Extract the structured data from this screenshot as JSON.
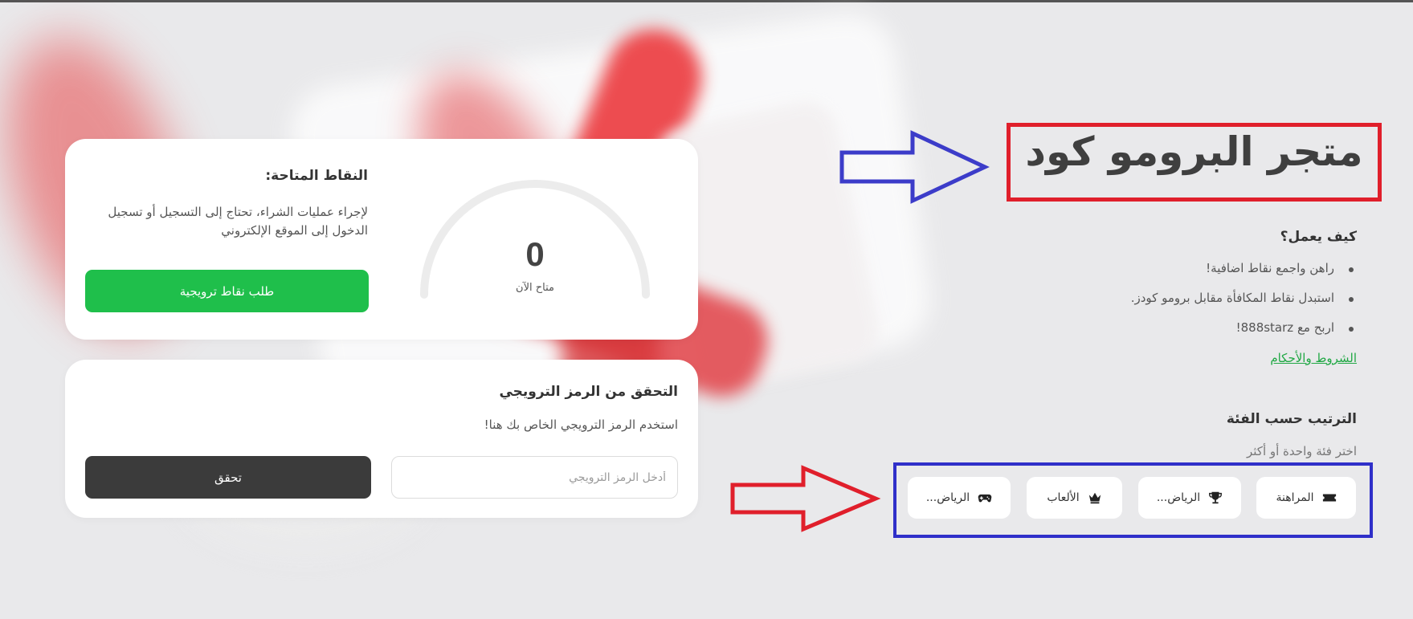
{
  "page": {
    "title": "متجر البرومو كود"
  },
  "points_card": {
    "title": "النقاط المتاحة:",
    "description": "لإجراء عمليات الشراء، تحتاج إلى التسجيل أو تسجيل الدخول إلى الموقع الإلكتروني",
    "button_label": "طلب نقاط ترويجية",
    "gauge_value": "0",
    "gauge_label": "متاح الآن"
  },
  "verify_card": {
    "title": "التحقق من الرمز الترويجي",
    "description": "استخدم الرمز الترويجي الخاص بك هنا!",
    "input_placeholder": "أدخل الرمز الترويجي",
    "button_label": "تحقق"
  },
  "how_it_works": {
    "title": "كيف يعمل؟",
    "steps": [
      "راهن واجمع نقاط اضافية!",
      "استبدل نقاط المكافأة مقابل برومو كودز.",
      "اربح مع 888starz!"
    ],
    "terms_link": "الشروط والأحكام"
  },
  "sorting": {
    "title": "الترتيب حسب الفئة",
    "description": "اختر فئة واحدة أو أكثر",
    "categories": [
      {
        "label": "المراهنة",
        "icon": "ticket-icon"
      },
      {
        "label": "الرياض...",
        "icon": "trophy-icon"
      },
      {
        "label": "الألعاب",
        "icon": "crown-icon"
      },
      {
        "label": "الرياض...",
        "icon": "gamepad-icon"
      }
    ]
  },
  "colors": {
    "green_button": "#1fbf4b",
    "dark_button": "#3b3b3b",
    "title_frame": "#e01f2b",
    "category_frame": "#2f2fc9",
    "link": "#20a844"
  }
}
